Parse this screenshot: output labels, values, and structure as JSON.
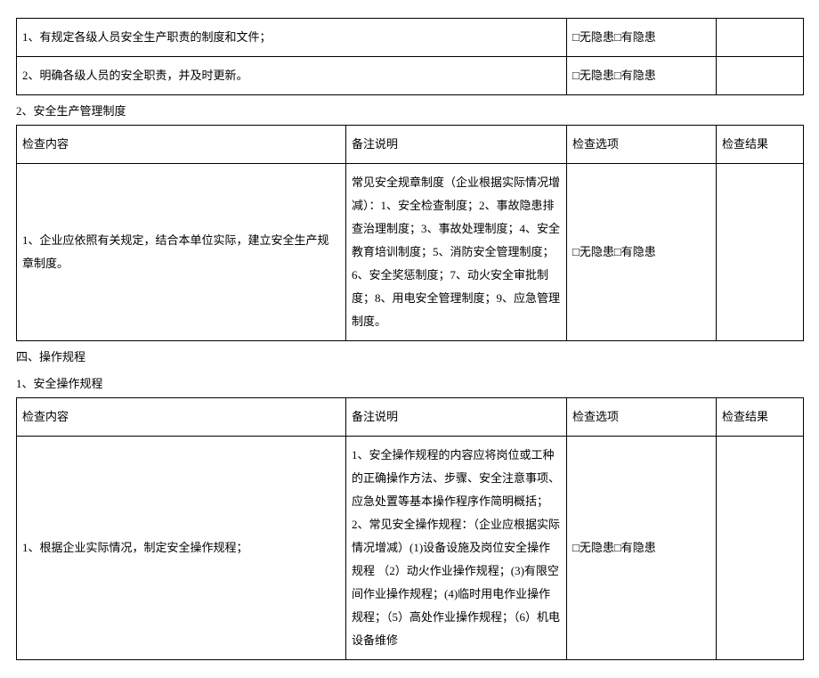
{
  "box": "□",
  "topTable": {
    "rows": [
      {
        "content": "1、有规定各级人员安全生产职责的制度和文件；",
        "option_a": "无隐患",
        "option_b": "有隐患"
      },
      {
        "content": "2、明确各级人员的安全职责，并及时更新。",
        "option_a": "无隐患",
        "option_b": "有隐患"
      }
    ]
  },
  "section2": {
    "title": "2、安全生产管理制度",
    "headers": {
      "content": "检查内容",
      "remark": "备注说明",
      "option": "检查选项",
      "result": "检查结果"
    },
    "row": {
      "content": "1、企业应依照有关规定，结合本单位实际，建立安全生产规章制度。",
      "remark": "常见安全规章制度（企业根据实际情况增减）：1、安全检查制度；2、事故隐患排查治理制度；3、事故处理制度；4、安全教育培训制度；5、消防安全管理制度；6、安全奖惩制度；7、动火安全审批制度；8、用电安全管理制度；9、应急管理制度。",
      "option_a": "无隐患",
      "option_b": "有隐患"
    }
  },
  "section4_title": "四、操作规程",
  "section4_sub": {
    "title": "1、安全操作规程",
    "headers": {
      "content": "检查内容",
      "remark": "备注说明",
      "option": "检查选项",
      "result": "检查结果"
    },
    "row": {
      "content": "1、根据企业实际情况，制定安全操作规程；",
      "remark": "1、安全操作规程的内容应将岗位或工种的正确操作方法、步骤、安全注意事项、应急处置等基本操作程序作简明概括；2、常见安全操作规程：（企业应根据实际情况增减）(1)设备设施及岗位安全操作规程 （2）动火作业操作规程；(3)有限空间作业操作规程；(4)临时用电作业操作规程；（5）高处作业操作规程；（6）机电设备维修",
      "option_a": "无隐患",
      "option_b": "有隐患"
    }
  }
}
